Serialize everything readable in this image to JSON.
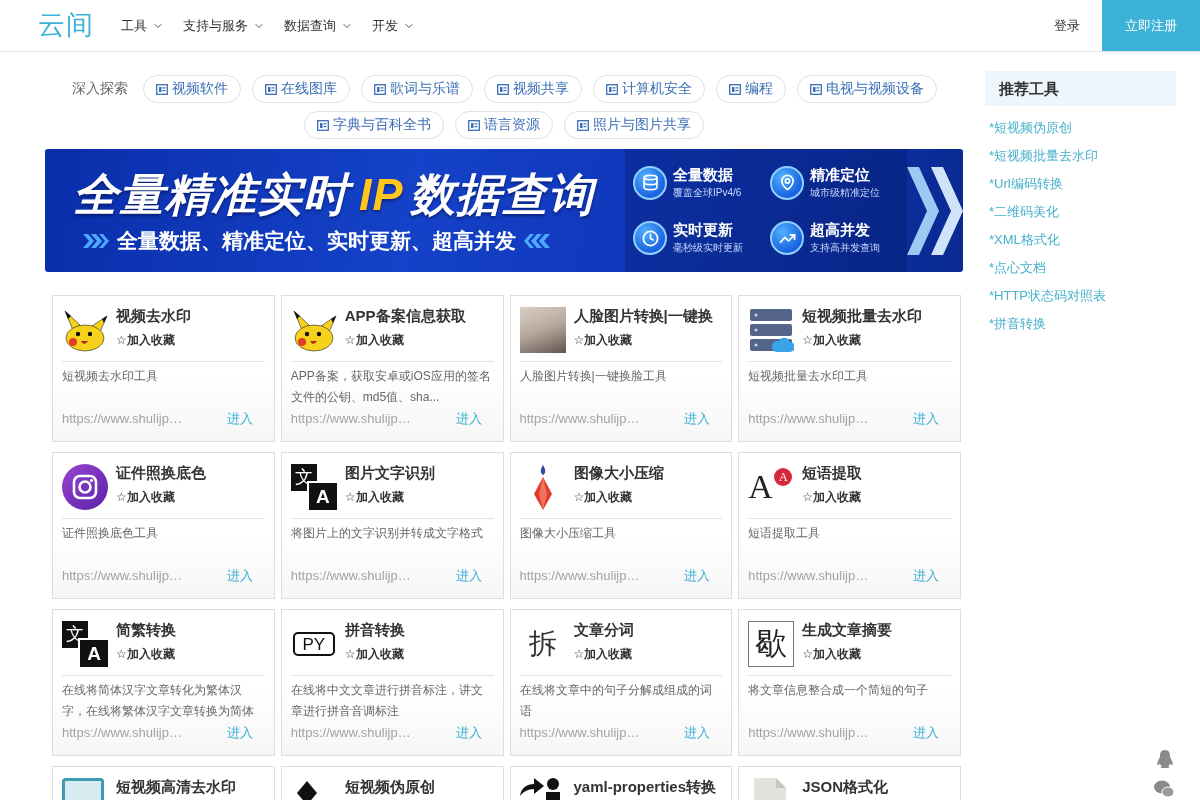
{
  "header": {
    "logo": "云间",
    "nav": [
      {
        "label": "工具"
      },
      {
        "label": "支持与服务"
      },
      {
        "label": "数据查询"
      },
      {
        "label": "开发"
      }
    ],
    "login": "登录",
    "register": "立即注册"
  },
  "explore": {
    "label": "深入探索",
    "tags": [
      "视频软件",
      "在线图库",
      "歌词与乐谱",
      "视频共享",
      "计算机安全",
      "编程",
      "电视与视频设备",
      "字典与百科全书",
      "语言资源",
      "照片与图片共享"
    ]
  },
  "banner": {
    "headline": "全量精准实时",
    "highlight": "IP",
    "headline_end": "数据查询",
    "subline": "全量数据、精准定位、实时更新、超高并发",
    "features": [
      {
        "kind": "database",
        "title": "全量数据",
        "subtitle": "覆盖全球IPv4/6"
      },
      {
        "kind": "location",
        "title": "精准定位",
        "subtitle": "城市级精准定位"
      },
      {
        "kind": "clock",
        "title": "实时更新",
        "subtitle": "毫秒级实时更新"
      },
      {
        "kind": "chart",
        "title": "超高并发",
        "subtitle": "支持高并发查询"
      }
    ]
  },
  "cards": [
    {
      "title": "视频去水印",
      "icon": {
        "kind": "pikachu"
      },
      "favorite": "☆加入收藏",
      "description": "短视频去水印工具",
      "url": "https://www.shulijp…",
      "action": "进入"
    },
    {
      "title": "APP备案信息获取",
      "icon": {
        "kind": "pikachu"
      },
      "favorite": "☆加入收藏",
      "description": "APP备案，获取安卓或iOS应用的签名文件的公钥、md5值、sha...",
      "url": "https://www.shulijp…",
      "action": "进入"
    },
    {
      "title": "人脸图片转换|一键换",
      "icon": {
        "kind": "photo"
      },
      "favorite": "☆加入收藏",
      "description": "人脸图片转换|一键换脸工具",
      "url": "https://www.shulijp…",
      "action": "进入"
    },
    {
      "title": "短视频批量去水印",
      "icon": {
        "kind": "server"
      },
      "favorite": "☆加入收藏",
      "description": "短视频批量去水印工具",
      "url": "https://www.shulijp…",
      "action": "进入"
    },
    {
      "title": "证件照换底色",
      "icon": {
        "kind": "camera"
      },
      "favorite": "☆加入收藏",
      "description": "证件照换底色工具",
      "url": "https://www.shulijp…",
      "action": "进入"
    },
    {
      "title": "图片文字识别",
      "icon": {
        "kind": "translate",
        "texts": [
          "文",
          "A"
        ]
      },
      "favorite": "☆加入收藏",
      "description": "将图片上的文字识别并转成文字格式",
      "url": "https://www.shulijp…",
      "action": "进入"
    },
    {
      "title": "图像大小压缩",
      "icon": {
        "kind": "gem"
      },
      "favorite": "☆加入收藏",
      "description": "图像大小压缩工具",
      "url": "https://www.shulijp…",
      "action": "进入"
    },
    {
      "title": "短语提取",
      "icon": {
        "kind": "letter-badge",
        "texts": [
          "A",
          "A"
        ]
      },
      "favorite": "☆加入收藏",
      "description": "短语提取工具",
      "url": "https://www.shulijp…",
      "action": "进入"
    },
    {
      "title": "简繁转换",
      "icon": {
        "kind": "translate",
        "texts": [
          "文",
          "A"
        ]
      },
      "favorite": "☆加入收藏",
      "description": "在线将简体汉字文章转化为繁体汉字，在线将繁体汉字文章转换为简体",
      "url": "https://www.shulijp…",
      "action": "进入"
    },
    {
      "title": "拼音转换",
      "icon": {
        "kind": "boxed",
        "texts": [
          "PY"
        ]
      },
      "favorite": "☆加入收藏",
      "description": "在线将中文文章进行拼音标注，讲文章进行拼音音调标注",
      "url": "https://www.shulijp…",
      "action": "进入"
    },
    {
      "title": "文章分词",
      "icon": {
        "kind": "glyph",
        "texts": [
          "拆"
        ]
      },
      "favorite": "☆加入收藏",
      "description": "在线将文章中的句子分解成组成的词语",
      "url": "https://www.shulijp…",
      "action": "进入"
    },
    {
      "title": "生成文章摘要",
      "icon": {
        "kind": "framed",
        "texts": [
          "歇"
        ]
      },
      "favorite": "☆加入收藏",
      "description": "将文章信息整合成一个简短的句子",
      "url": "https://www.shulijp…",
      "action": "进入"
    },
    {
      "title": "短视频高清去水印",
      "icon": {
        "kind": "monitor"
      }
    },
    {
      "title": "短视频伪原创",
      "icon": {
        "kind": "dark-diamond"
      }
    },
    {
      "title": "yaml-properties转换",
      "icon": {
        "kind": "share"
      }
    },
    {
      "title": "JSON格式化",
      "icon": {
        "kind": "document"
      }
    }
  ],
  "sidebar": {
    "title": "推荐工具",
    "links": [
      "*短视频伪原创",
      "*短视频批量去水印",
      "*Url编码转换",
      "*二维码美化",
      "*XML格式化",
      "*点心文档",
      "*HTTP状态码对照表",
      "*拼音转换"
    ]
  }
}
